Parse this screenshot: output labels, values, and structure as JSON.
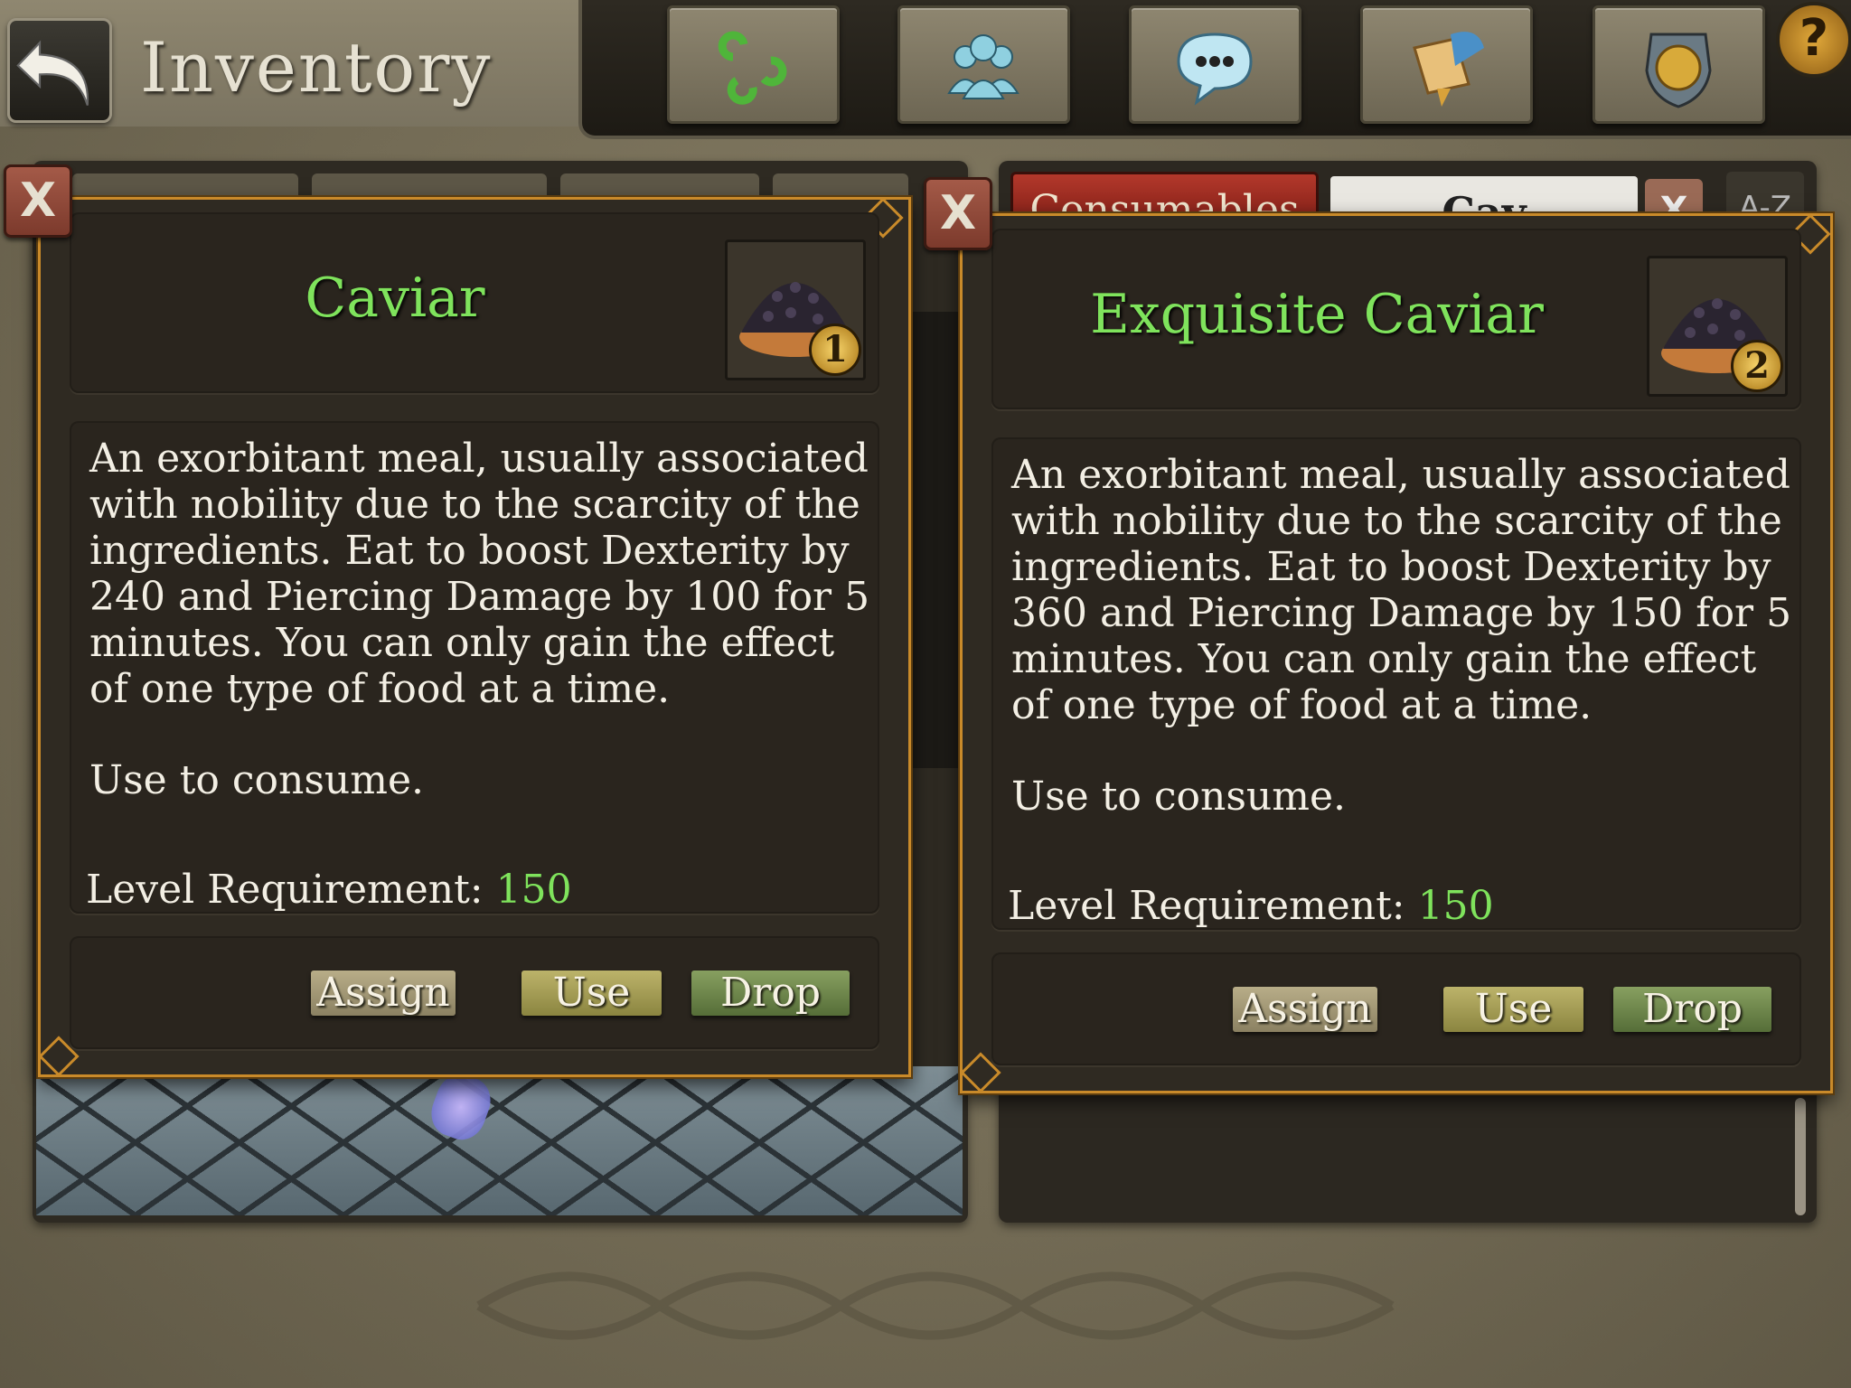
{
  "header": {
    "title": "Inventory",
    "toolbar_icons": [
      "triskele-icon",
      "party-icon",
      "chat-icon",
      "quest-scroll-icon",
      "guild-crest-icon"
    ],
    "help_label": "?"
  },
  "inventory": {
    "category_tab": "Consumables",
    "search_value": "Cav",
    "clear_label": "X",
    "sort_label": "A-Z"
  },
  "dialogs": [
    {
      "name": "Caviar",
      "stack": "1",
      "description": "An exorbitant meal, usually associated with nobility due to the scarcity of the ingredients. Eat to boost Dexterity by 240 and Piercing Damage by 100 for 5 minutes. You can only gain the effect of one type of food at a time.",
      "usage": "Use to consume.",
      "level_label": "Level Requirement:",
      "level_value": "150",
      "close_label": "X",
      "buttons": {
        "assign": "Assign",
        "use": "Use",
        "drop": "Drop"
      }
    },
    {
      "name": "Exquisite Caviar",
      "stack": "2",
      "description": "An exorbitant meal, usually associated with nobility due to the scarcity of the ingredients. Eat to boost Dexterity by 360 and Piercing Damage by 150 for 5 minutes. You can only gain the effect of one type of food at a time.",
      "usage": "Use to consume.",
      "level_label": "Level Requirement:",
      "level_value": "150",
      "close_label": "X",
      "buttons": {
        "assign": "Assign",
        "use": "Use",
        "drop": "Drop"
      }
    }
  ],
  "colors": {
    "item_name": "#7fe35c",
    "dialog_border": "#c98a2a",
    "close_button": "#a45a48",
    "category_tab": "#b3382b"
  }
}
